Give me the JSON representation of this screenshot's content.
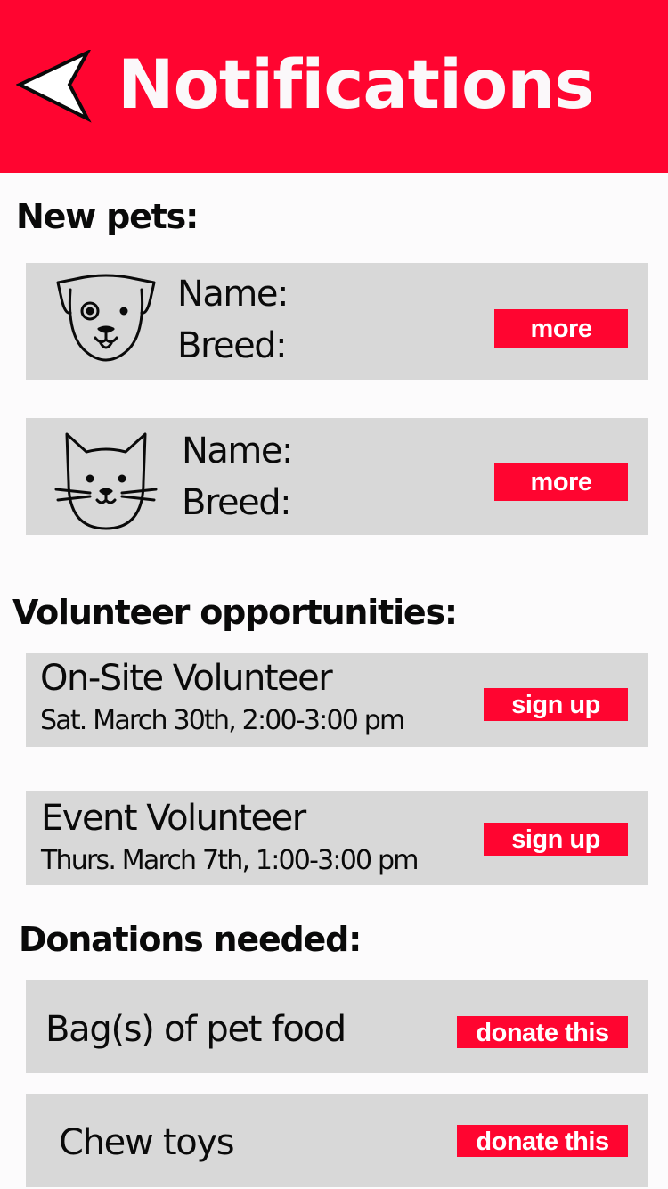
{
  "header": {
    "title": "Notifications",
    "back_icon": "back-arrow-icon",
    "background_color": "#ff0530"
  },
  "new_pets": {
    "title": "New pets:",
    "items": [
      {
        "icon": "dog-icon",
        "name_label": "Name:",
        "breed_label": "Breed:",
        "button_label": "more"
      },
      {
        "icon": "cat-icon",
        "name_label": "Name:",
        "breed_label": "Breed:",
        "button_label": "more"
      }
    ]
  },
  "volunteer": {
    "title": "Volunteer opportunities:",
    "items": [
      {
        "title": "On-Site Volunteer",
        "date": "Sat. March 30th, 2:00-3:00 pm",
        "button_label": "sign up"
      },
      {
        "title": "Event Volunteer",
        "date": "Thurs. March 7th, 1:00-3:00 pm",
        "button_label": "sign up"
      }
    ]
  },
  "donations": {
    "title": "Donations needed:",
    "items": [
      {
        "label": "Bag(s) of pet food",
        "button_label": "donate this"
      },
      {
        "label": "Chew toys",
        "button_label": "donate this"
      }
    ]
  },
  "colors": {
    "accent": "#ff0530",
    "card_background": "#d8d8d8",
    "page_background": "#fcfbfc"
  }
}
